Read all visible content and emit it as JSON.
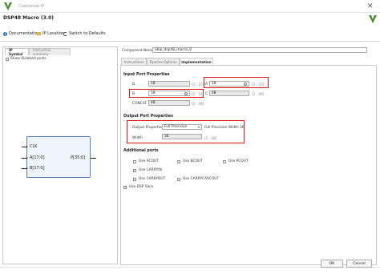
{
  "window": {
    "title": "Customize IP",
    "close_label": "✕"
  },
  "header": {
    "ip_name": "DSP48 Macro (3.0)",
    "toolbar": {
      "documentation": "Documentation",
      "ip_location": "IP Location",
      "switch_defaults": "Switch to Defaults"
    }
  },
  "left": {
    "tabs": [
      {
        "label": "IP Symbol",
        "active": true
      },
      {
        "label": "Instruction summary",
        "active": false
      }
    ],
    "show_disabled_ports": "Show disabled ports",
    "symbol": {
      "clk": "CLK",
      "a": "A[17:0]",
      "b": "B[17:0]",
      "p": "P[35:0]"
    }
  },
  "right": {
    "component_name_label": "Component Name",
    "component_name_value": "xbip_dsp48_macro_0",
    "tabs": [
      {
        "label": "Instructions",
        "active": false
      },
      {
        "label": "Pipeline Options",
        "active": false
      },
      {
        "label": "Implementation",
        "active": true
      }
    ],
    "input_port_title": "Input Port Properties",
    "ports": {
      "d": {
        "label": "D",
        "value": "18",
        "range": "[2 - 25]"
      },
      "a": {
        "label": "A",
        "value": "18",
        "range": "[2 - 25]"
      },
      "b": {
        "label": "B",
        "value": "18",
        "range": "[2 - 18]"
      },
      "c": {
        "label": "C",
        "value": "48",
        "range": "[2 - 48]"
      },
      "concat": {
        "label": "CONCAT",
        "value": "48",
        "range": "[2 - 48]"
      }
    },
    "output_port_title": "Output Port Properties",
    "output_properties_label": "Output Properties",
    "output_properties_value": "Full Precision",
    "full_precision_width": "Full Precision Width 36",
    "width_label": "Width",
    "width_value": "36",
    "width_range": "[2 - 48]",
    "additional_ports_title": "Additional ports",
    "additional_ports": [
      {
        "label": "Use ACOUT",
        "checked": false
      },
      {
        "label": "Use BCOUT",
        "checked": false
      },
      {
        "label": "Use PCOUT",
        "checked": false
      },
      {
        "label": "Use CARRYIN",
        "checked": false
      },
      {
        "label": "Use CARRYOUT",
        "checked": false
      },
      {
        "label": "Use CARRYCASCOUT",
        "checked": false
      }
    ],
    "use_dsp_slice": {
      "label": "Use DSP Slice",
      "checked": true
    }
  },
  "footer": {
    "ok": "OK",
    "cancel": "Cancel"
  },
  "colors": {
    "highlight_red": "#e01818",
    "symbol_border": "#5b7fb8",
    "symbol_fill": "#eef4fb"
  }
}
